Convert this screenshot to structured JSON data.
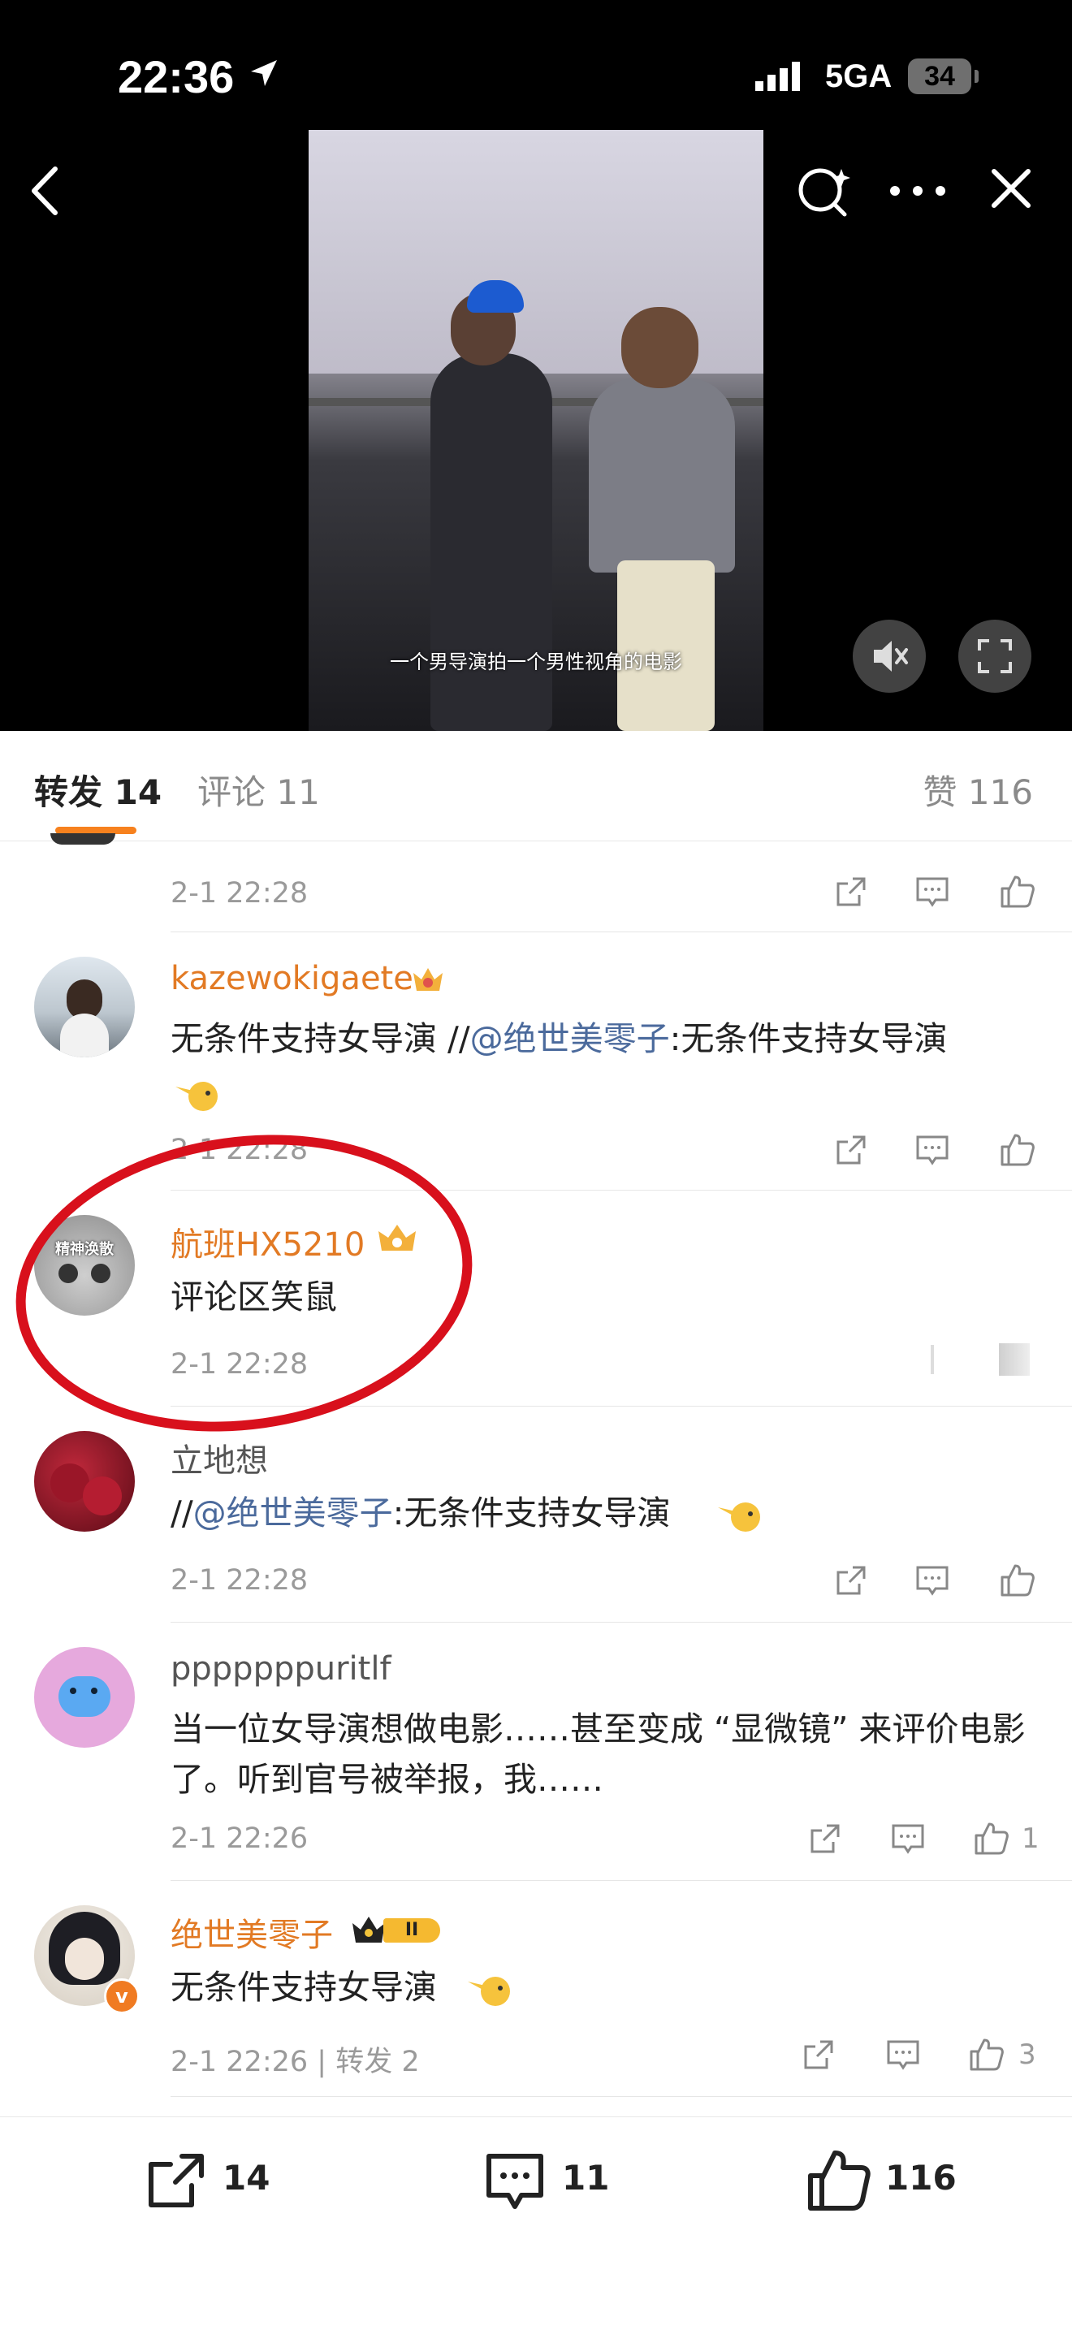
{
  "status": {
    "time": "22:36",
    "network": "5GA",
    "battery": "34"
  },
  "video": {
    "subtitle": "一个男导演拍一个男性视角的电影"
  },
  "tabs": {
    "forward": "转发 14",
    "comments": "评论 11",
    "likes": "赞 116"
  },
  "items": [
    {
      "name": "",
      "text": "",
      "time": "2-1 22:28",
      "like_count": ""
    },
    {
      "name": "kazewokigaete",
      "text_plain": "无条件支持女导演 //",
      "mention": "@绝世美零子",
      "text_after": ":无条件支持女导演",
      "time": "2-1 22:28",
      "like_count": ""
    },
    {
      "name": "航班HX5210",
      "text": "评论区笑鼠",
      "time": "2-1 22:28",
      "avatar_text": "精神涣散",
      "like_count": ""
    },
    {
      "name": "立地想",
      "text_plain": "//",
      "mention": "@绝世美零子",
      "text_after": ":无条件支持女导演",
      "time": "2-1 22:28",
      "like_count": ""
    },
    {
      "name": "pppppppuritlf",
      "text": "当一位女导演想做电影……甚至变成 “显微镜” 来评价电影了。听到官号被举报，我……",
      "time": "2-1 22:26",
      "like_count": "1"
    },
    {
      "name": "绝世美零子",
      "text": "无条件支持女导演",
      "time": "2-1 22:26 | 转发 2",
      "like_count": "3",
      "badge": "II"
    }
  ],
  "bottom": {
    "forward_count": "14",
    "comment_count": "11",
    "like_count": "116"
  },
  "colors": {
    "accent": "#f7811e",
    "username": "#e27a24",
    "mention": "#4b6a9c",
    "annotation": "#d8101c"
  }
}
